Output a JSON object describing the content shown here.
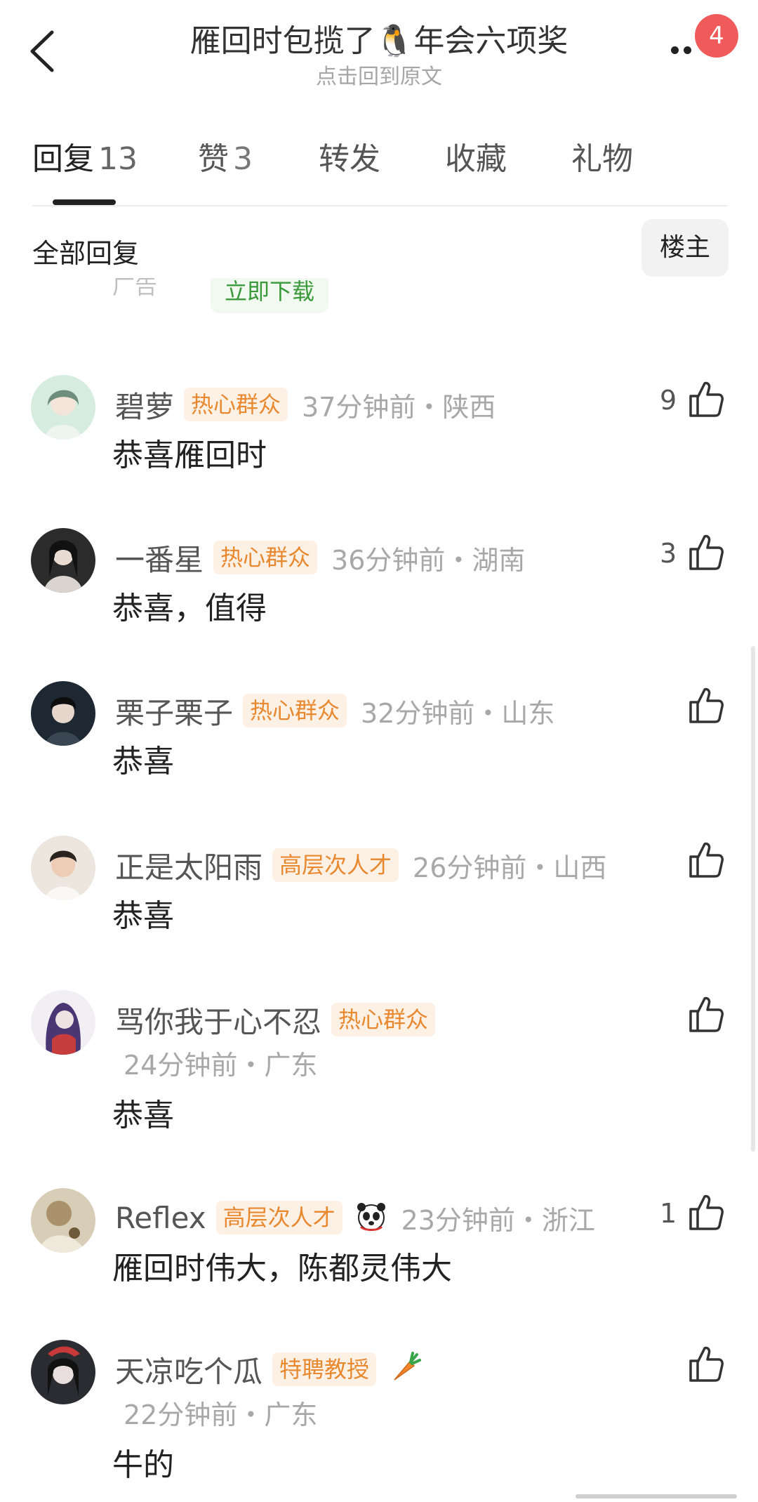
{
  "header": {
    "title": "雁回时包揽了🐧年会六项奖",
    "subtitle": "点击回到原文",
    "badge_count": "4"
  },
  "tabs": [
    {
      "label": "回复",
      "count": "13",
      "active": true
    },
    {
      "label": "赞",
      "count": "3",
      "active": false
    },
    {
      "label": "转发",
      "count": "",
      "active": false
    },
    {
      "label": "收藏",
      "count": "",
      "active": false
    },
    {
      "label": "礼物",
      "count": "",
      "active": false
    }
  ],
  "filter": {
    "label": "全部回复",
    "op_button": "楼主"
  },
  "ad": {
    "text": "广告",
    "button": "立即下载"
  },
  "comments": [
    {
      "user": "碧萝",
      "tag": "热心群众",
      "time_loc": "37分钟前・陕西",
      "text": "恭喜雁回时",
      "likes": "9",
      "avatar_color": "#cfe9d9"
    },
    {
      "user": "一番星",
      "tag": "热心群众",
      "time_loc": "36分钟前・湖南",
      "text": "恭喜，值得",
      "likes": "3",
      "avatar_color": "#2a2a2a"
    },
    {
      "user": "栗子栗子",
      "tag": "热心群众",
      "time_loc": "32分钟前・山东",
      "text": "恭喜",
      "likes": "",
      "avatar_color": "#1f2b36"
    },
    {
      "user": "正是太阳雨",
      "tag": "高层次人才",
      "time_loc": "26分钟前・山西",
      "text": "恭喜",
      "likes": "",
      "avatar_color": "#e7e1da"
    },
    {
      "user": "骂你我于心不忍",
      "tag": "热心群众",
      "time_loc": "24分钟前・广东",
      "text": "恭喜",
      "likes": "",
      "avatar_color": "#4b3a6e"
    },
    {
      "user": "Reflex",
      "tag": "高层次人才",
      "time_loc": "23分钟前・浙江",
      "text": "雁回时伟大，陈都灵伟大",
      "likes": "1",
      "avatar_color": "#cbbfa8",
      "emoji": "panda-icon"
    },
    {
      "user": "天凉吃个瓜",
      "tag": "特聘教授",
      "time_loc": "22分钟前・广东",
      "text": "牛的",
      "likes": "",
      "avatar_color": "#2c2c30",
      "emoji": "carrot-icon"
    }
  ]
}
